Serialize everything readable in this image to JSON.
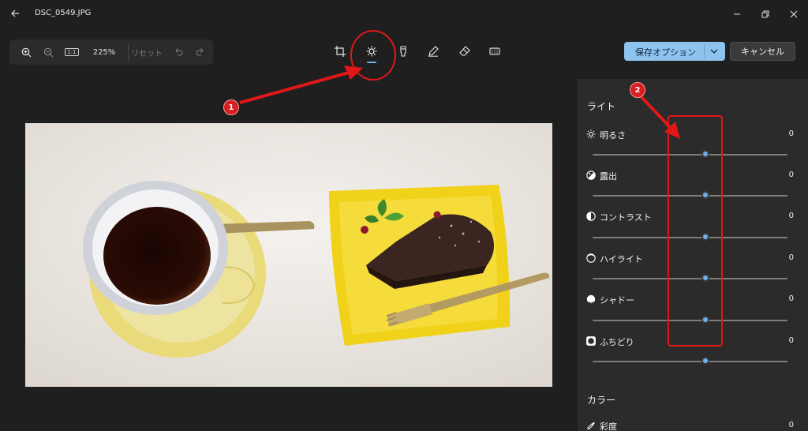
{
  "window": {
    "title": "DSC_0549.JPG"
  },
  "zoom": {
    "level": "225%",
    "reset_label": "リセット",
    "actual_size_label": "1:1"
  },
  "toolbar": {
    "tools": [
      {
        "name": "crop",
        "icon": "crop-icon"
      },
      {
        "name": "adjust",
        "icon": "brightness-icon",
        "selected": true
      },
      {
        "name": "filter",
        "icon": "filter-icon"
      },
      {
        "name": "markup",
        "icon": "pen-icon"
      },
      {
        "name": "erase",
        "icon": "eraser-icon"
      },
      {
        "name": "background",
        "icon": "background-blur-icon"
      }
    ],
    "save_label": "保存オプション",
    "cancel_label": "キャンセル"
  },
  "panel": {
    "light_heading": "ライト",
    "color_heading": "カラー",
    "adjustments": [
      {
        "label": "明るさ",
        "value": "0",
        "icon": "brightness-icon"
      },
      {
        "label": "露出",
        "value": "0",
        "icon": "exposure-icon"
      },
      {
        "label": "コントラスト",
        "value": "0",
        "icon": "contrast-icon"
      },
      {
        "label": "ハイライト",
        "value": "0",
        "icon": "highlight-icon"
      },
      {
        "label": "シャドー",
        "value": "0",
        "icon": "shadow-icon"
      },
      {
        "label": "ふちどり",
        "value": "0",
        "icon": "vignette-icon"
      }
    ],
    "color_adjustments": [
      {
        "label": "彩度",
        "value": "0",
        "icon": "saturation-icon"
      }
    ]
  },
  "annotations": {
    "badge1": "1",
    "badge2": "2"
  },
  "colors": {
    "accent": "#8ec3ef",
    "slider": "#6fb0f0",
    "annotation": "#e01818"
  }
}
